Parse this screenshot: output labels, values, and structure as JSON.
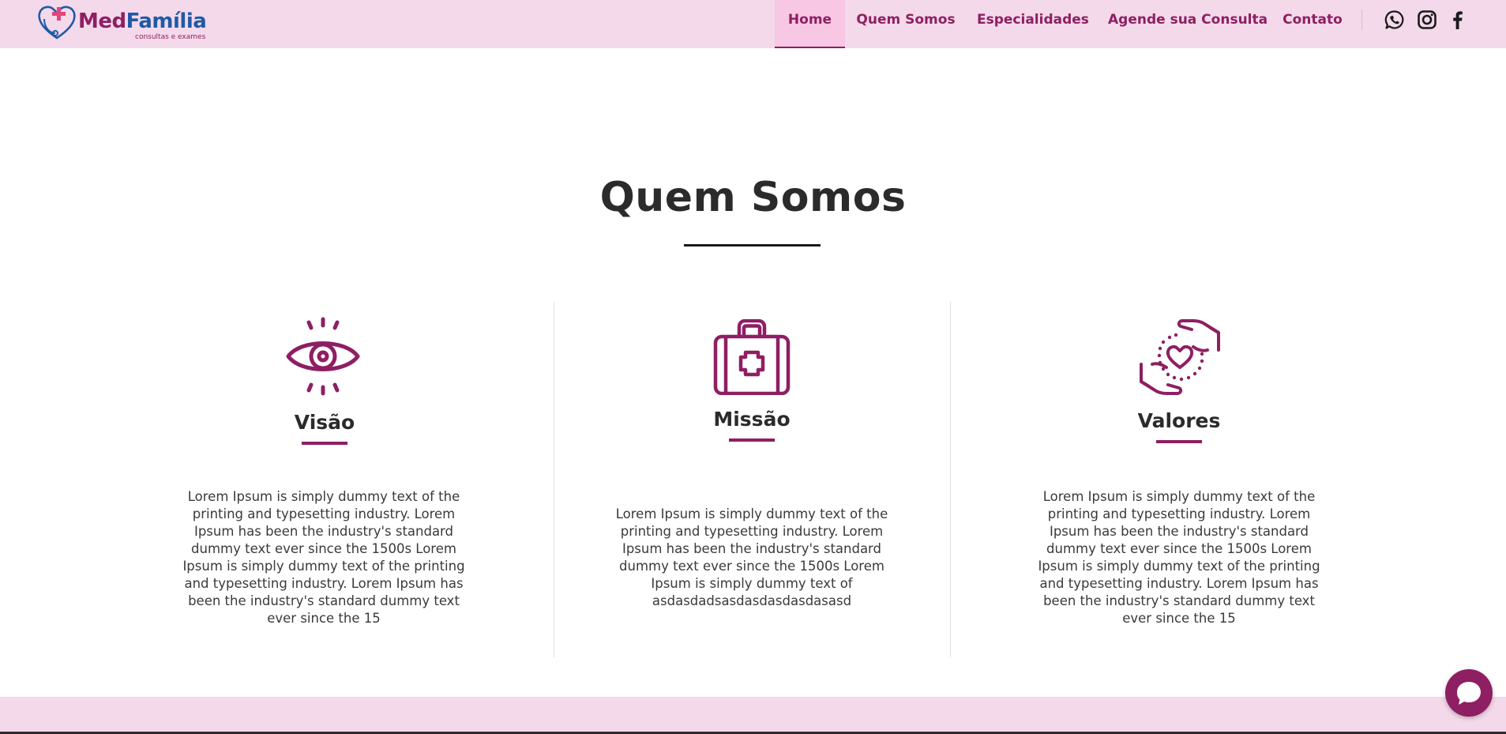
{
  "brand": {
    "name_part1": "Med",
    "name_part2": "Família",
    "tagline": "consultas e exames",
    "primary_color": "#8e1f63",
    "secondary_color": "#1f5aa6",
    "header_bg": "#f4d9ea"
  },
  "nav": {
    "items": [
      {
        "label": "Home",
        "active": true
      },
      {
        "label": "Quem Somos",
        "active": false
      },
      {
        "label": "Especialidades",
        "active": false
      },
      {
        "label": "Agende sua Consulta",
        "active": false
      },
      {
        "label": "Contato",
        "active": false
      }
    ],
    "social": [
      "whatsapp-icon",
      "instagram-icon",
      "facebook-icon"
    ]
  },
  "about": {
    "title": "Quem Somos",
    "cards": [
      {
        "icon": "eye-icon",
        "heading": "Visão",
        "text": "Lorem Ipsum is simply dummy text of the printing and typesetting industry. Lorem Ipsum has been the industry's standard dummy text ever since the 1500s Lorem Ipsum is simply dummy text of the printing and typesetting industry. Lorem Ipsum has been the industry's standard dummy text ever since the 15"
      },
      {
        "icon": "medical-kit-icon",
        "heading": "Missão",
        "text": "Lorem Ipsum is simply dummy text of the printing and typesetting industry. Lorem Ipsum has been the industry's standard dummy text ever since the 1500s Lorem Ipsum is simply dummy text of asdasdadsasdasdasdasdasasd"
      },
      {
        "icon": "hands-heart-icon",
        "heading": "Valores",
        "text": "Lorem Ipsum is simply dummy text of the printing and typesetting industry. Lorem Ipsum has been the industry's standard dummy text ever since the 1500s Lorem Ipsum is simply dummy text of the printing and typesetting industry. Lorem Ipsum has been the industry's standard dummy text ever since the 15"
      }
    ]
  },
  "chat": {
    "icon": "chat-bubble-icon"
  }
}
